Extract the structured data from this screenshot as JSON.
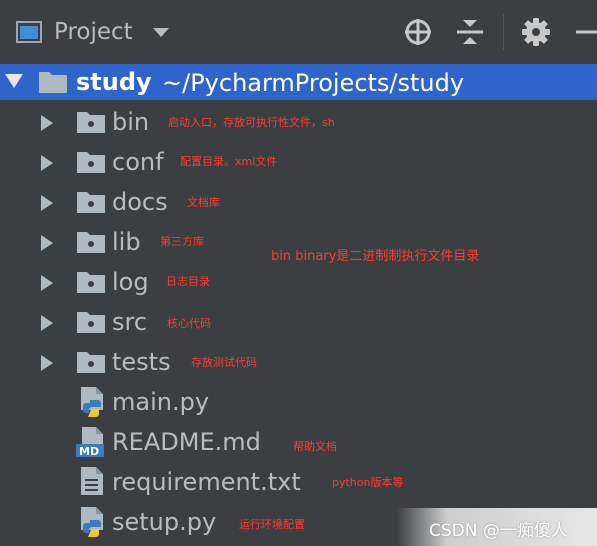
{
  "toolbar": {
    "title": "Project"
  },
  "root": {
    "name": "study",
    "path": "~/PycharmProjects/study"
  },
  "items": [
    {
      "name": "bin",
      "kind": "folder",
      "note": "启动入口，存放可执行性文件，sh"
    },
    {
      "name": "conf",
      "kind": "folder",
      "note": "配置目录。xml文件"
    },
    {
      "name": "docs",
      "kind": "folder",
      "note": "文档库"
    },
    {
      "name": "lib",
      "kind": "folder",
      "note": "第三方库"
    },
    {
      "name": "log",
      "kind": "folder",
      "note": "日志目录"
    },
    {
      "name": "src",
      "kind": "folder",
      "note": "核心代码"
    },
    {
      "name": "tests",
      "kind": "folder",
      "note": "存放测试代码"
    },
    {
      "name": "main.py",
      "kind": "python",
      "note": ""
    },
    {
      "name": "README.md",
      "kind": "markdown",
      "note": "帮助文档"
    },
    {
      "name": "requirement.txt",
      "kind": "text",
      "note": "python版本等"
    },
    {
      "name": "setup.py",
      "kind": "python",
      "note": "运行环境配置"
    }
  ],
  "annotation": "bin binary是二进制制执行文件目录",
  "watermark": "CSDN @一痴傻人",
  "colors": {
    "background": "#3c3f41",
    "selection": "#2f65ca",
    "note": "#ff3b30"
  }
}
